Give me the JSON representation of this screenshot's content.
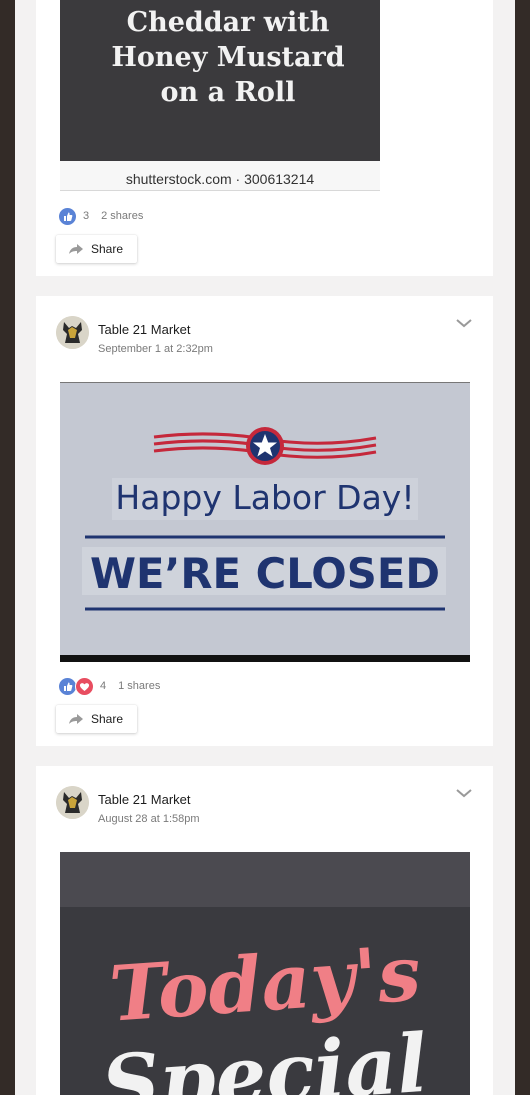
{
  "posts": [
    {
      "image_text": {
        "lines": [
          "Cheddar with",
          "Honey Mustard",
          "on a Roll"
        ],
        "watermark": "shutterstock.com · 300613214"
      },
      "reactions": {
        "count": "3",
        "shares": "2 shares"
      },
      "share_label": "Share"
    },
    {
      "page_name": "Table 21 Market",
      "time": "September 1 at 2:32pm",
      "image_text": {
        "line1": "Happy Labor Day!",
        "line2": "WE’RE CLOSED"
      },
      "reactions": {
        "count": "4",
        "shares": "1 shares"
      },
      "share_label": "Share"
    },
    {
      "page_name": "Table 21 Market",
      "time": "August 28 at 1:58pm",
      "image_text": {
        "line1": "Today's",
        "line2": "Special"
      }
    }
  ],
  "colors": {
    "page_bg": "#332b27",
    "feed_bg": "#f3f2f2",
    "like": "#5a83d6",
    "love": "#e84d60",
    "labor_blue": "#1f3470",
    "labor_red": "#c5283b",
    "special_pink": "#f07f86"
  },
  "icons": [
    "like-icon",
    "love-icon",
    "share-icon",
    "chevron-down-icon",
    "star-icon"
  ]
}
